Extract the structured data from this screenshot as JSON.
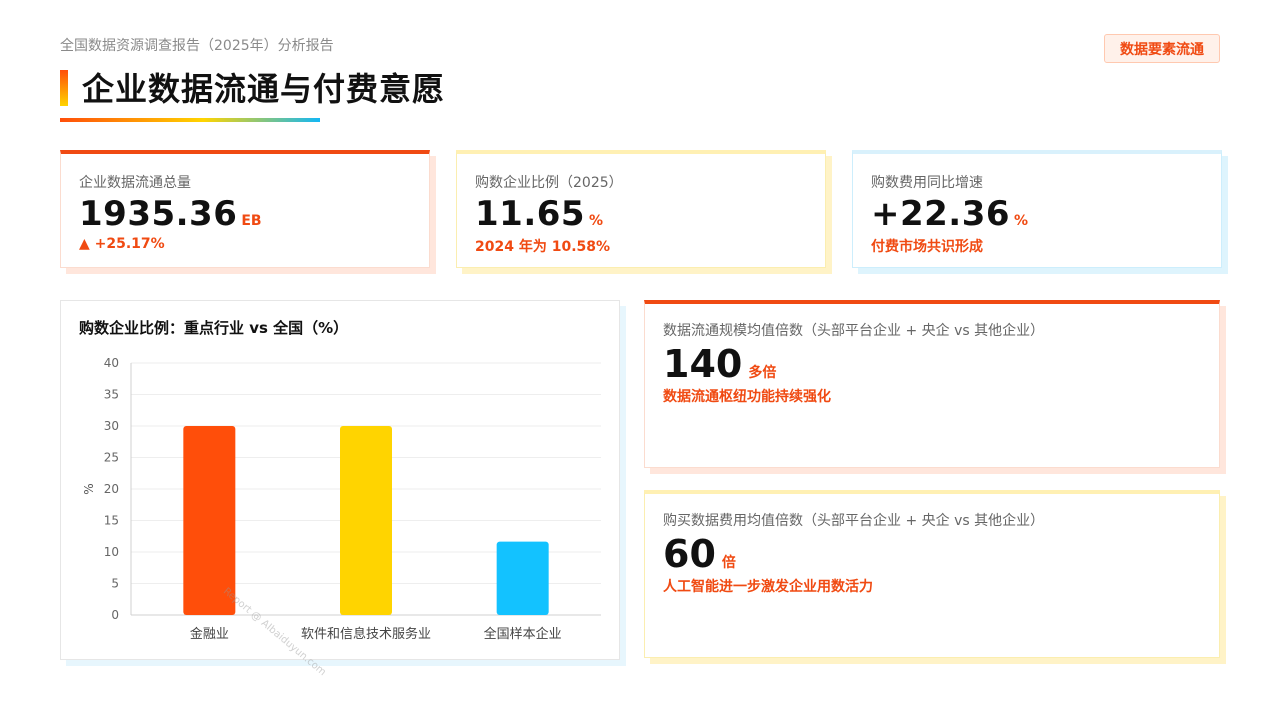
{
  "header": {
    "breadcrumb": "全国数据资源调查报告（2025年）分析报告",
    "title": "企业数据流通与付费意愿",
    "tag": "数据要素流通"
  },
  "kpis": [
    {
      "label": "企业数据流通总量",
      "value": "1935.36",
      "unit": "EB",
      "sub": "▲ +25.17%"
    },
    {
      "label": "购数企业比例（2025）",
      "value": "11.65",
      "unit": "%",
      "sub": "2024 年为 10.58%"
    },
    {
      "label": "购数费用同比增速",
      "value": "+22.36",
      "unit": "%",
      "sub": "付费市场共识形成"
    }
  ],
  "highlights": [
    {
      "label": "数据流通规模均值倍数（头部平台企业 + 央企 vs 其他企业）",
      "value": "140",
      "unit": "多倍",
      "sub": "数据流通枢纽功能持续强化"
    },
    {
      "label": "购买数据费用均值倍数（头部平台企业 + 央企 vs 其他企业）",
      "value": "60",
      "unit": "倍",
      "sub": "人工智能进一步激发企业用数活力"
    }
  ],
  "watermark": "Report @ AIbaiduyun.com",
  "colors": {
    "accent": "#f04a12",
    "bar_colors": [
      "#ff4e0a",
      "#ffd400",
      "#13c2ff"
    ]
  },
  "chart_data": {
    "type": "bar",
    "title": "购数企业比例：重点行业 vs 全国（%）",
    "categories": [
      "金融业",
      "软件和信息技术服务业",
      "全国样本企业"
    ],
    "values": [
      30,
      30,
      11.65
    ],
    "ylabel": "%",
    "xlabel": "",
    "ylim": [
      0,
      40
    ],
    "yticks": [
      0,
      5,
      10,
      15,
      20,
      25,
      30,
      35,
      40
    ],
    "grid": true,
    "legend": "none"
  }
}
